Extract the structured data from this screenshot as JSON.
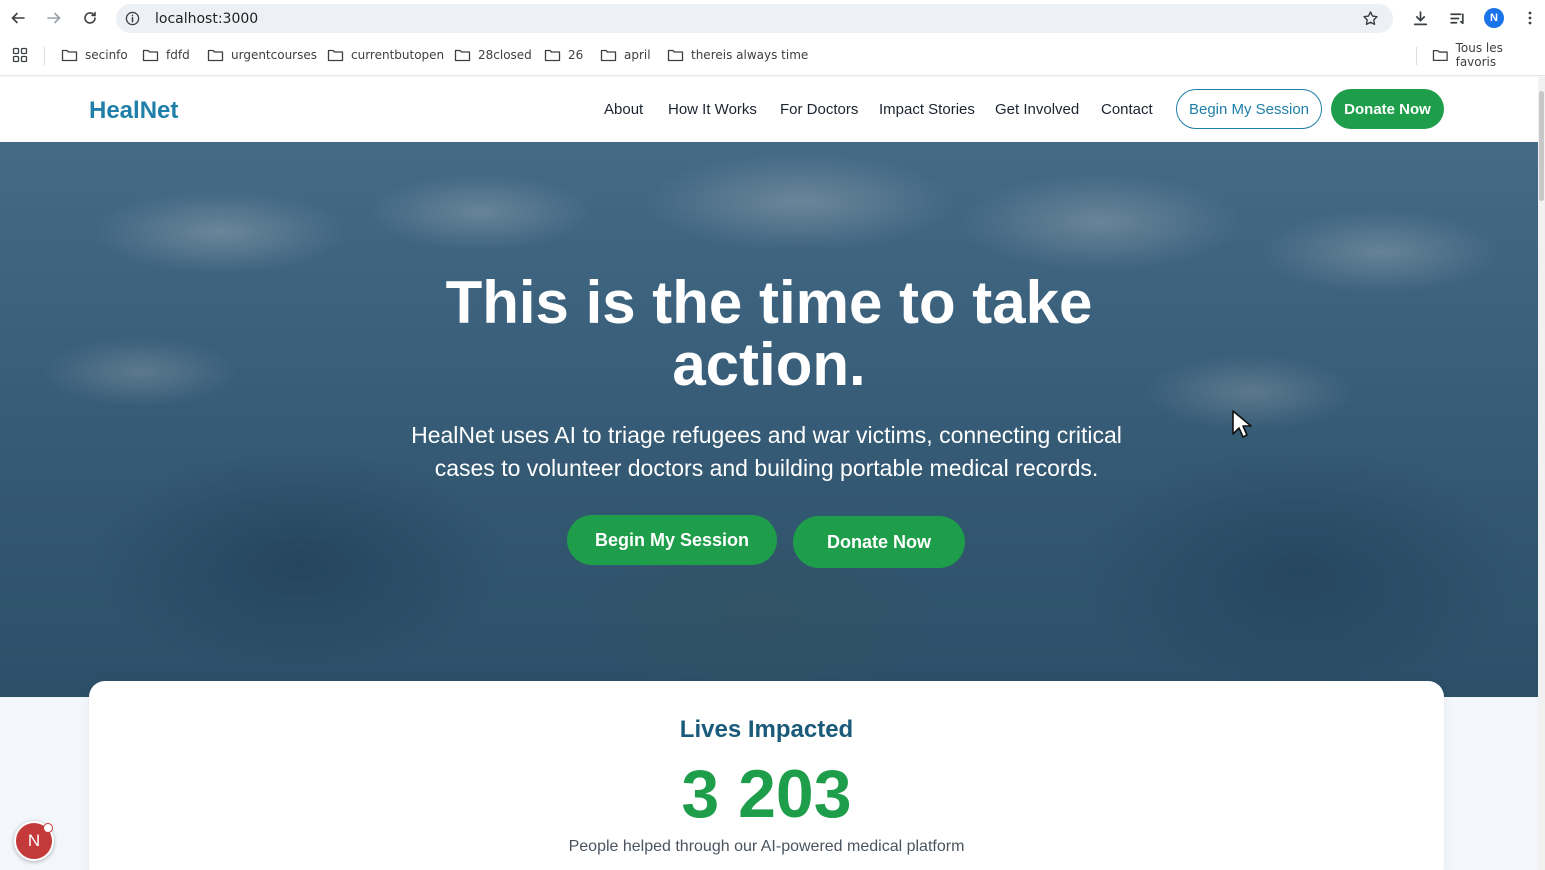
{
  "browser": {
    "url": "localhost:3000",
    "profile_initial": "N",
    "bookmarks": [
      {
        "label": "secinfo"
      },
      {
        "label": "fdfd"
      },
      {
        "label": "urgentcourses"
      },
      {
        "label": "currentbutopen"
      },
      {
        "label": "28closed"
      },
      {
        "label": "26"
      },
      {
        "label": "april"
      },
      {
        "label": "thereis always time"
      }
    ],
    "all_bookmarks_label": "Tous les favoris"
  },
  "site": {
    "logo": "HealNet",
    "nav": [
      {
        "label": "About"
      },
      {
        "label": "How It Works"
      },
      {
        "label": "For Doctors"
      },
      {
        "label": "Impact Stories"
      },
      {
        "label": "Get Involved"
      },
      {
        "label": "Contact"
      }
    ],
    "header_buttons": {
      "begin": "Begin My Session",
      "donate": "Donate Now"
    }
  },
  "hero": {
    "title_line1": "This is the time to take",
    "title_line2": "action.",
    "subtitle_line1": "HealNet uses AI to triage refugees and war victims, connecting critical",
    "subtitle_line2": "cases to volunteer doctors and building portable medical records.",
    "primary_button": "Begin My Session",
    "secondary_button": "Donate Now"
  },
  "impact": {
    "title": "Lives Impacted",
    "count": "3 203",
    "description": "People helped through our AI-powered medical platform"
  },
  "dev_badge": {
    "label": "N"
  },
  "colors": {
    "brand_blue": "#1f7fa8",
    "brand_green": "#1e9e4a",
    "impact_title": "#1a5a7a"
  }
}
